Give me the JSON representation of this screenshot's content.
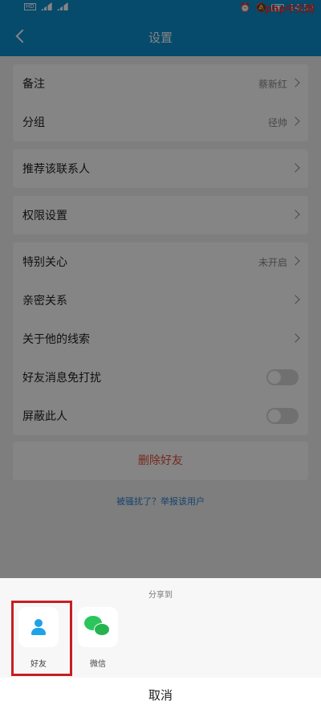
{
  "status": {
    "time": "14:52",
    "watermark": "php中文网"
  },
  "header": {
    "title": "设置"
  },
  "rows": [
    {
      "label": "备注",
      "value": "蔡新红"
    },
    {
      "label": "分组",
      "value": "径帅"
    },
    {
      "label": "推荐该联系人",
      "value": ""
    },
    {
      "label": "权限设置",
      "value": ""
    },
    {
      "label": "特别关心",
      "value": "未开启"
    },
    {
      "label": "亲密关系",
      "value": ""
    },
    {
      "label": "关于他的线索",
      "value": ""
    },
    {
      "label": "好友消息免打扰",
      "value": ""
    },
    {
      "label": "屏蔽此人",
      "value": ""
    }
  ],
  "delete_button": "删除好友",
  "report_link": "被骚扰了？举报该用户",
  "sheet": {
    "title": "分享到",
    "items": [
      {
        "label": "好友",
        "icon": "friend-icon"
      },
      {
        "label": "微信",
        "icon": "wechat-icon"
      }
    ],
    "cancel": "取消"
  },
  "colors": {
    "header": "#0d8fcf",
    "delete": "#e0503a",
    "link": "#2b7fd0",
    "highlight": "#c81e22"
  }
}
